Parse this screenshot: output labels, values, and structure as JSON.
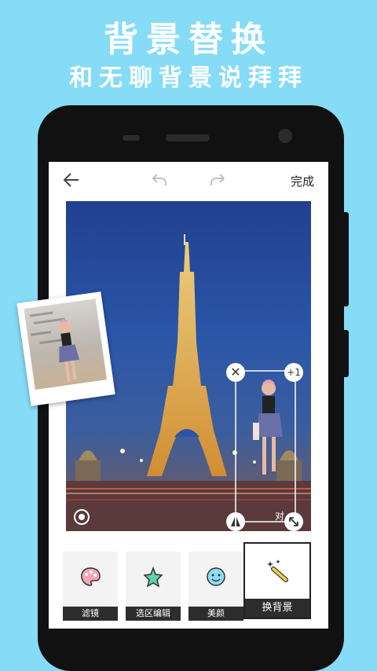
{
  "headline": {
    "title": "背景替换",
    "subtitle": "和无聊背景说拜拜"
  },
  "editor": {
    "done_label": "完成",
    "back_icon": "arrow-left-icon",
    "undo_icon": "undo-icon",
    "redo_icon": "redo-icon",
    "sticker_count": "+1",
    "sticker_partial_text": "对"
  },
  "tools": [
    {
      "label": "滤镜",
      "icon": "palette-icon"
    },
    {
      "label": "选区编辑",
      "icon": "star-shape-icon"
    },
    {
      "label": "美颜",
      "icon": "smiley-icon"
    },
    {
      "label": "换背景",
      "icon": "magic-wand-icon"
    }
  ],
  "colors": {
    "background": "#86dbf7",
    "phone": "#111111",
    "toolbar_label": "#2d2d2d"
  }
}
